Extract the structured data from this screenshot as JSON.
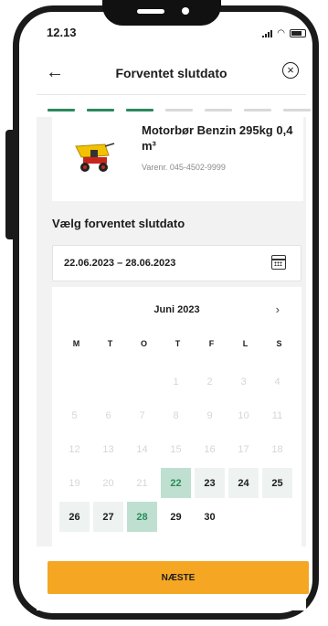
{
  "status_bar": {
    "time": "12.13",
    "icons": [
      "signal-icon",
      "wifi-icon",
      "battery-icon"
    ]
  },
  "header": {
    "title": "Forventet slutdato",
    "back_icon": "arrow-left-icon",
    "close_icon": "close-circle-icon"
  },
  "progress": {
    "total_steps": 7,
    "completed_steps": 3,
    "accent": "#2b8a5c"
  },
  "product": {
    "name": "Motorbør Benzin 295kg 0,4 m³",
    "sku": "Varenr. 045-4502-9999"
  },
  "date_section": {
    "label": "Vælg forventet slutdato",
    "value": "22.06.2023 – 28.06.2023"
  },
  "calendar": {
    "month": "Juni 2023",
    "weekdays": [
      "M",
      "T",
      "O",
      "T",
      "F",
      "L",
      "S"
    ],
    "days": [
      {
        "t": "",
        "s": "empty"
      },
      {
        "t": "",
        "s": "empty"
      },
      {
        "t": "",
        "s": "empty"
      },
      {
        "t": "1",
        "s": "disabled"
      },
      {
        "t": "2",
        "s": "disabled"
      },
      {
        "t": "3",
        "s": "disabled"
      },
      {
        "t": "4",
        "s": "disabled"
      },
      {
        "t": "5",
        "s": "disabled"
      },
      {
        "t": "6",
        "s": "disabled"
      },
      {
        "t": "7",
        "s": "disabled"
      },
      {
        "t": "8",
        "s": "disabled"
      },
      {
        "t": "9",
        "s": "disabled"
      },
      {
        "t": "10",
        "s": "disabled"
      },
      {
        "t": "11",
        "s": "disabled"
      },
      {
        "t": "12",
        "s": "disabled"
      },
      {
        "t": "13",
        "s": "disabled"
      },
      {
        "t": "14",
        "s": "disabled"
      },
      {
        "t": "15",
        "s": "disabled"
      },
      {
        "t": "16",
        "s": "disabled"
      },
      {
        "t": "17",
        "s": "disabled"
      },
      {
        "t": "18",
        "s": "disabled"
      },
      {
        "t": "19",
        "s": "disabled"
      },
      {
        "t": "20",
        "s": "disabled"
      },
      {
        "t": "21",
        "s": "disabled"
      },
      {
        "t": "22",
        "s": "edge"
      },
      {
        "t": "23",
        "s": "in-range"
      },
      {
        "t": "24",
        "s": "in-range"
      },
      {
        "t": "25",
        "s": "in-range"
      },
      {
        "t": "26",
        "s": "in-range"
      },
      {
        "t": "27",
        "s": "in-range"
      },
      {
        "t": "28",
        "s": "edge"
      },
      {
        "t": "29",
        "s": "normal"
      },
      {
        "t": "30",
        "s": "normal"
      }
    ],
    "next_icon": "chevron-right-icon",
    "range_color": "#eef3f1",
    "selected_color": "#bfe0d0"
  },
  "footer": {
    "next_label": "NÆSTE",
    "button_color": "#f5a623"
  }
}
